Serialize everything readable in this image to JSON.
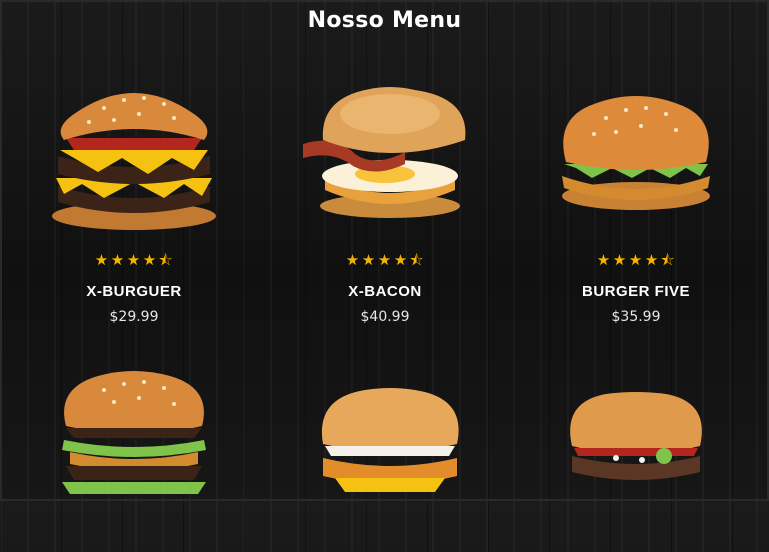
{
  "header": {
    "title": "Nosso Menu"
  },
  "menu": [
    {
      "name": "X-BURGUER",
      "price": "$29.99",
      "rating": 4.5
    },
    {
      "name": "X-BACON",
      "price": "$40.99",
      "rating": 4.5
    },
    {
      "name": "BURGER FIVE",
      "price": "$35.99",
      "rating": 4.5
    },
    {
      "name": "",
      "price": "",
      "rating": null
    },
    {
      "name": "",
      "price": "",
      "rating": null
    },
    {
      "name": "",
      "price": "",
      "rating": null
    }
  ],
  "colors": {
    "star": "#f4b400",
    "bun": "#d9893b",
    "cheese": "#f5c211",
    "patty": "#3b2417",
    "lettuce": "#7fc34a"
  },
  "icons": {
    "star": "star-icon",
    "half_star": "half-star-icon"
  }
}
